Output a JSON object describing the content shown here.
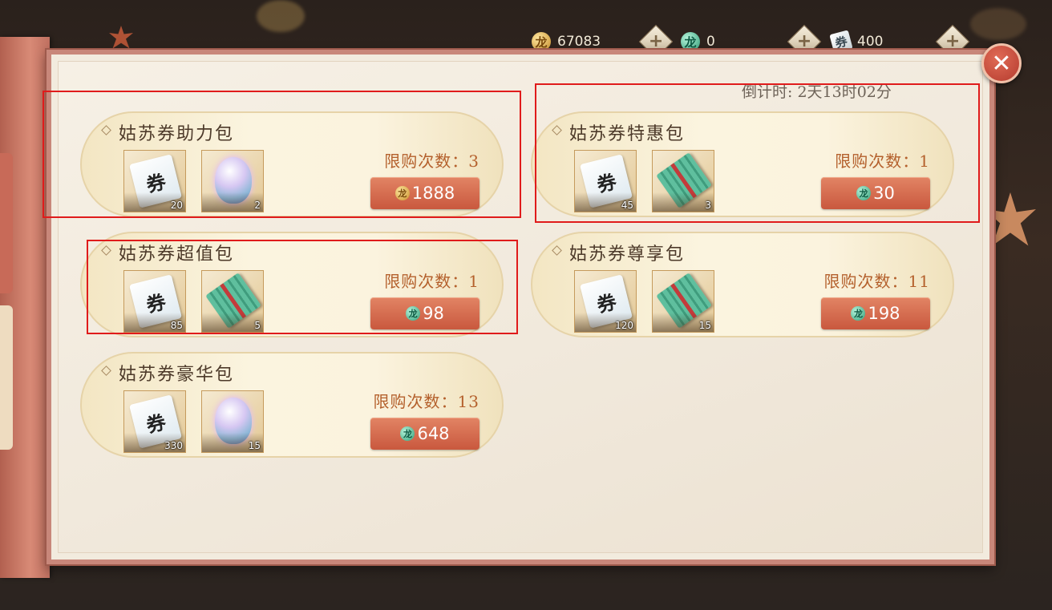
{
  "currencies": [
    {
      "icon": "gold-dragon-coin-icon",
      "symbol": "龙",
      "value": "67083"
    },
    {
      "icon": "jade-dragon-coin-icon",
      "symbol": "龙",
      "value": "0"
    },
    {
      "icon": "gusu-ticket-icon",
      "symbol": "券",
      "value": "400"
    }
  ],
  "plus_label": "+",
  "close_label": "✕",
  "countdown": "倒计时: 2天13时02分",
  "packs": [
    {
      "title": "姑苏券助力包",
      "limit": "限购次数：3",
      "price": "1888",
      "currency": "gold",
      "items": [
        {
          "type": "ticket",
          "glyph": "券",
          "count": "20"
        },
        {
          "type": "gem",
          "glyph": "",
          "count": "2"
        }
      ]
    },
    {
      "title": "姑苏券特惠包",
      "limit": "限购次数：1",
      "price": "30",
      "currency": "jade",
      "items": [
        {
          "type": "ticket",
          "glyph": "券",
          "count": "45"
        },
        {
          "type": "bills",
          "glyph": "",
          "count": "3"
        }
      ]
    },
    {
      "title": "姑苏券超值包",
      "limit": "限购次数：1",
      "price": "98",
      "currency": "jade",
      "items": [
        {
          "type": "ticket",
          "glyph": "券",
          "count": "85"
        },
        {
          "type": "bills",
          "glyph": "",
          "count": "5"
        }
      ]
    },
    {
      "title": "姑苏券尊享包",
      "limit": "限购次数：11",
      "price": "198",
      "currency": "jade",
      "items": [
        {
          "type": "ticket",
          "glyph": "券",
          "count": "120"
        },
        {
          "type": "bills",
          "glyph": "",
          "count": "15"
        }
      ]
    },
    {
      "title": "姑苏券豪华包",
      "limit": "限购次数：13",
      "price": "648",
      "currency": "jade",
      "items": [
        {
          "type": "ticket",
          "glyph": "券",
          "count": "330"
        },
        {
          "type": "gem",
          "glyph": "",
          "count": "15"
        }
      ]
    }
  ],
  "colors": {
    "highlight": "#e01b1b",
    "buy_button": "#d46a4d",
    "panel": "#f2ebde",
    "limit_text": "#b4602c"
  }
}
